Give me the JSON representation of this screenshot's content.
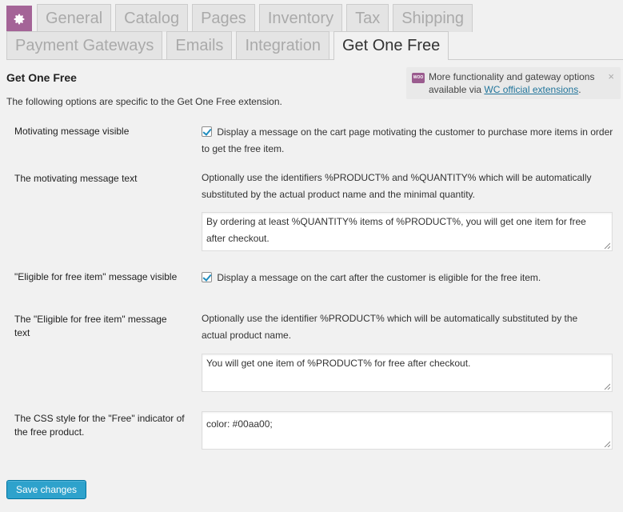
{
  "tabs": {
    "row1": [
      "General",
      "Catalog",
      "Pages",
      "Inventory",
      "Tax",
      "Shipping"
    ],
    "row2": [
      "Payment Gateways",
      "Emails",
      "Integration",
      "Get One Free"
    ],
    "active": "Get One Free",
    "gear_icon": "gear-icon"
  },
  "section": {
    "title": "Get One Free",
    "intro": "The following options are specific to the Get One Free extension."
  },
  "notice": {
    "logo_text": "WOO",
    "line1": "More functionality and gateway options",
    "line2_prefix": "available via ",
    "link_text": "WC official extensions",
    "line2_suffix": ".",
    "close": "×"
  },
  "fields": {
    "motivating_visible": {
      "label": "Motivating message visible",
      "checked": true,
      "description": "Display a message on the cart page motivating the customer to purchase more items in order to get the free item."
    },
    "motivating_text": {
      "label": "The motivating message text",
      "help": "Optionally use the identifiers %PRODUCT% and %QUANTITY% which will be automatically substituted by the actual product name and the minimal quantity.",
      "value": "By ordering at least %QUANTITY% items of %PRODUCT%, you will get one item for free after checkout."
    },
    "eligible_visible": {
      "label": "\"Eligible for free item\" message visible",
      "checked": true,
      "description": "Display a message on the cart after the customer is eligible for the free item."
    },
    "eligible_text": {
      "label": "The \"Eligible for free item\" message text",
      "help": "Optionally use the identifier %PRODUCT% which will be automatically substituted by the actual product name.",
      "value": "You will get one item of %PRODUCT% for free after checkout."
    },
    "css_style": {
      "label": "The CSS style for the \"Free\" indicator of the free product.",
      "value": "color: #00aa00;"
    }
  },
  "actions": {
    "save_label": "Save changes"
  },
  "colors": {
    "brand": "#a46497",
    "button": "#2ea2cc",
    "link": "#21759b"
  }
}
